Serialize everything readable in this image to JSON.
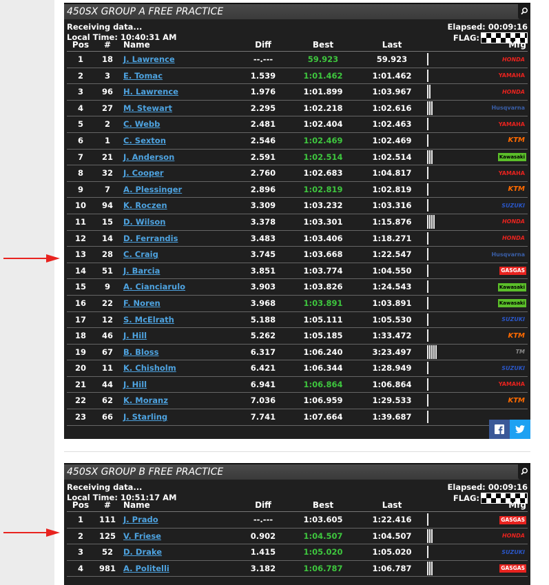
{
  "colors": {
    "accent_green": "#3ec63e",
    "link_blue": "#4ea3e0",
    "arrow_red": "#e8231f"
  },
  "columns": {
    "pos": "Pos",
    "num": "#",
    "name": "Name",
    "diff": "Diff",
    "best": "Best",
    "last": "Last",
    "mfg": "Mfg"
  },
  "sessionA": {
    "title": "450SX GROUP A FREE PRACTICE",
    "status": "Receiving data...",
    "local_time": "Local Time: 10:40:31 AM",
    "elapsed": "Elapsed: 00:09:16",
    "flag_label": "FLAG:",
    "rows": [
      {
        "pos": "1",
        "num": "18",
        "name": "J. Lawrence",
        "diff": "--.---",
        "best": "59.923",
        "last": "59.923",
        "best_green": true,
        "bars": 0,
        "mfg": "HONDA"
      },
      {
        "pos": "2",
        "num": "3",
        "name": "E. Tomac",
        "diff": "1.539",
        "best": "1:01.462",
        "last": "1:01.462",
        "best_green": true,
        "bars": 0,
        "mfg": "YAMAHA"
      },
      {
        "pos": "3",
        "num": "96",
        "name": "H. Lawrence",
        "diff": "1.976",
        "best": "1:01.899",
        "last": "1:03.967",
        "best_green": false,
        "bars": 2,
        "mfg": "HONDA"
      },
      {
        "pos": "4",
        "num": "27",
        "name": "M. Stewart",
        "diff": "2.295",
        "best": "1:02.218",
        "last": "1:02.616",
        "best_green": false,
        "bars": 3,
        "mfg": "Husqvarna"
      },
      {
        "pos": "5",
        "num": "2",
        "name": "C. Webb",
        "diff": "2.481",
        "best": "1:02.404",
        "last": "1:02.463",
        "best_green": false,
        "bars": 0,
        "mfg": "YAMAHA"
      },
      {
        "pos": "6",
        "num": "1",
        "name": "C. Sexton",
        "diff": "2.546",
        "best": "1:02.469",
        "last": "1:02.469",
        "best_green": true,
        "bars": 0,
        "mfg": "KTM"
      },
      {
        "pos": "7",
        "num": "21",
        "name": "J. Anderson",
        "diff": "2.591",
        "best": "1:02.514",
        "last": "1:02.514",
        "best_green": true,
        "bars": 3,
        "mfg": "Kawasaki"
      },
      {
        "pos": "8",
        "num": "32",
        "name": "J. Cooper",
        "diff": "2.760",
        "best": "1:02.683",
        "last": "1:04.817",
        "best_green": false,
        "bars": 0,
        "mfg": "YAMAHA"
      },
      {
        "pos": "9",
        "num": "7",
        "name": "A. Plessinger",
        "diff": "2.896",
        "best": "1:02.819",
        "last": "1:02.819",
        "best_green": true,
        "bars": 0,
        "mfg": "KTM"
      },
      {
        "pos": "10",
        "num": "94",
        "name": "K. Roczen",
        "diff": "3.309",
        "best": "1:03.232",
        "last": "1:03.316",
        "best_green": false,
        "bars": 0,
        "mfg": "SUZUKI"
      },
      {
        "pos": "11",
        "num": "15",
        "name": "D. Wilson",
        "diff": "3.378",
        "best": "1:03.301",
        "last": "1:15.876",
        "best_green": false,
        "bars": 4,
        "mfg": "HONDA"
      },
      {
        "pos": "12",
        "num": "14",
        "name": "D. Ferrandis",
        "diff": "3.483",
        "best": "1:03.406",
        "last": "1:18.271",
        "best_green": false,
        "bars": 0,
        "mfg": "HONDA"
      },
      {
        "pos": "13",
        "num": "28",
        "name": "C. Craig",
        "diff": "3.745",
        "best": "1:03.668",
        "last": "1:22.547",
        "best_green": false,
        "bars": 0,
        "mfg": "Husqvarna"
      },
      {
        "pos": "14",
        "num": "51",
        "name": "J. Barcia",
        "diff": "3.851",
        "best": "1:03.774",
        "last": "1:04.550",
        "best_green": false,
        "bars": 0,
        "mfg": "GASGAS"
      },
      {
        "pos": "15",
        "num": "9",
        "name": "A. Cianciarulo",
        "diff": "3.903",
        "best": "1:03.826",
        "last": "1:24.543",
        "best_green": false,
        "bars": 0,
        "mfg": "Kawasaki"
      },
      {
        "pos": "16",
        "num": "22",
        "name": "F. Noren",
        "diff": "3.968",
        "best": "1:03.891",
        "last": "1:03.891",
        "best_green": true,
        "bars": 0,
        "mfg": "Kawasaki"
      },
      {
        "pos": "17",
        "num": "12",
        "name": "S. McElrath",
        "diff": "5.188",
        "best": "1:05.111",
        "last": "1:05.530",
        "best_green": false,
        "bars": 0,
        "mfg": "SUZUKI"
      },
      {
        "pos": "18",
        "num": "46",
        "name": "J. Hill",
        "diff": "5.262",
        "best": "1:05.185",
        "last": "1:33.472",
        "best_green": false,
        "bars": 0,
        "mfg": "KTM"
      },
      {
        "pos": "19",
        "num": "67",
        "name": "B. Bloss",
        "diff": "6.317",
        "best": "1:06.240",
        "last": "3:23.497",
        "best_green": false,
        "bars": 5,
        "mfg": "TM"
      },
      {
        "pos": "20",
        "num": "11",
        "name": "K. Chisholm",
        "diff": "6.421",
        "best": "1:06.344",
        "last": "1:28.949",
        "best_green": false,
        "bars": 0,
        "mfg": "SUZUKI"
      },
      {
        "pos": "21",
        "num": "44",
        "name": "J. Hill",
        "diff": "6.941",
        "best": "1:06.864",
        "last": "1:06.864",
        "best_green": true,
        "bars": 0,
        "mfg": "YAMAHA"
      },
      {
        "pos": "22",
        "num": "62",
        "name": "K. Moranz",
        "diff": "7.036",
        "best": "1:06.959",
        "last": "1:29.533",
        "best_green": false,
        "bars": 0,
        "mfg": "KTM"
      },
      {
        "pos": "23",
        "num": "66",
        "name": "J. Starling",
        "diff": "7.741",
        "best": "1:07.664",
        "last": "1:39.687",
        "best_green": false,
        "bars": 0,
        "mfg": ""
      }
    ]
  },
  "sessionB": {
    "title": "450SX GROUP B FREE PRACTICE",
    "status": "Receiving data...",
    "local_time": "Local Time: 10:51:17 AM",
    "elapsed": "Elapsed: 00:09:16",
    "flag_label": "FLAG:",
    "rows": [
      {
        "pos": "1",
        "num": "111",
        "name": "J. Prado",
        "diff": "--.---",
        "best": "1:03.605",
        "last": "1:22.416",
        "best_green": false,
        "bars": 0,
        "mfg": "GASGAS"
      },
      {
        "pos": "2",
        "num": "125",
        "name": "V. Friese",
        "diff": "0.902",
        "best": "1:04.507",
        "last": "1:04.507",
        "best_green": true,
        "bars": 3,
        "mfg": "HONDA"
      },
      {
        "pos": "3",
        "num": "52",
        "name": "D. Drake",
        "diff": "1.415",
        "best": "1:05.020",
        "last": "1:05.020",
        "best_green": true,
        "bars": 0,
        "mfg": "SUZUKI"
      },
      {
        "pos": "4",
        "num": "981",
        "name": "A. Politelli",
        "diff": "3.182",
        "best": "1:06.787",
        "last": "1:06.787",
        "best_green": true,
        "bars": 3,
        "mfg": "GASGAS"
      }
    ]
  }
}
